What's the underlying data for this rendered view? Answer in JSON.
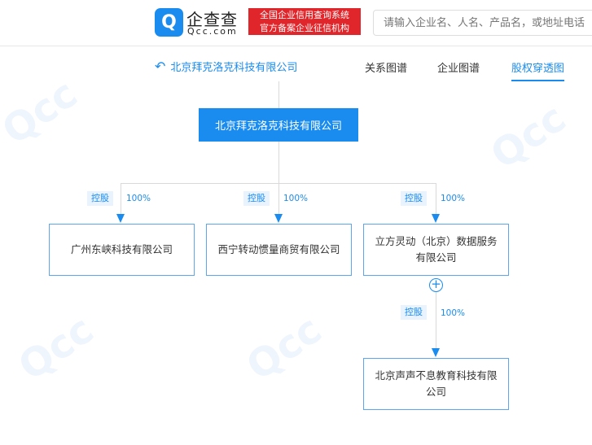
{
  "header": {
    "logo_text": "企查查",
    "logo_domain": "Qcc.com",
    "badge_line1": "全国企业信用查询系统",
    "badge_line2": "官方备案企业征信机构",
    "search_placeholder": "请输入企业名、人名、产品名，或地址电话"
  },
  "nav": {
    "back_label": "北京拜克洛克科技有限公司",
    "tabs": [
      {
        "label": "关系图谱"
      },
      {
        "label": "企业图谱"
      },
      {
        "label": "股权穿透图"
      }
    ],
    "active_tab": "股权穿透图"
  },
  "tree": {
    "root": "北京拜克洛克科技有限公司",
    "children": [
      {
        "name": "广州东峡科技有限公司",
        "relation": "控股",
        "percent": "100%"
      },
      {
        "name": "西宁转动惯量商贸有限公司",
        "relation": "控股",
        "percent": "100%"
      },
      {
        "name": "立方灵动（北京）数据服务有限公司",
        "relation": "控股",
        "percent": "100%"
      }
    ],
    "grandchild": {
      "name": "北京声声不息教育科技有限公司",
      "relation": "控股",
      "percent": "100%"
    },
    "expand_symbol": "+"
  },
  "colors": {
    "brand": "#1a8cf0",
    "badge": "#e0262b"
  }
}
